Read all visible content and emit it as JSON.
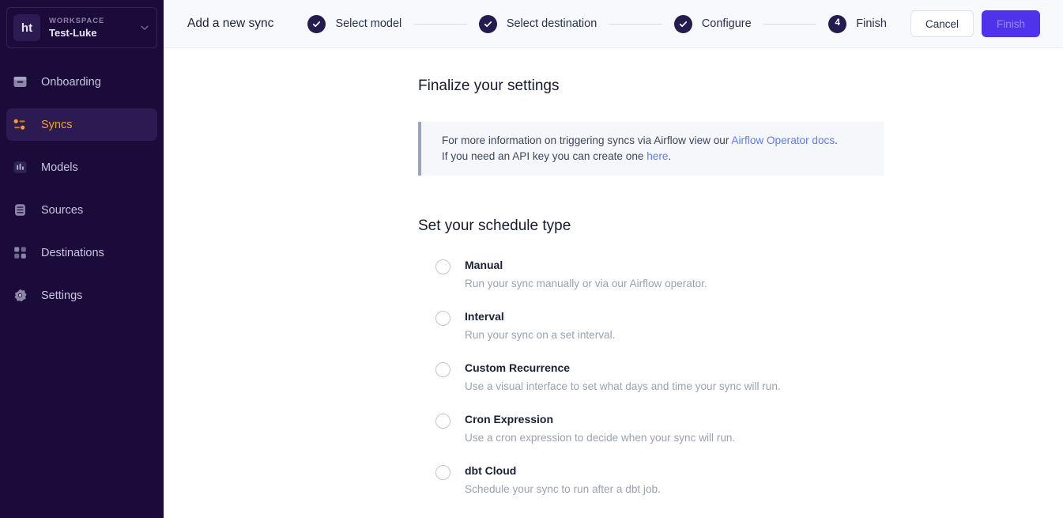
{
  "sidebar": {
    "workspace": {
      "avatar_initials": "ht",
      "label": "WORKSPACE",
      "name": "Test-Luke",
      "chevron_icon": "chevron-down-icon"
    },
    "items": [
      {
        "label": "Onboarding",
        "icon": "onboarding-icon",
        "active": false
      },
      {
        "label": "Syncs",
        "icon": "syncs-icon",
        "active": true
      },
      {
        "label": "Models",
        "icon": "models-icon",
        "active": false
      },
      {
        "label": "Sources",
        "icon": "sources-icon",
        "active": false
      },
      {
        "label": "Destinations",
        "icon": "destinations-icon",
        "active": false
      },
      {
        "label": "Settings",
        "icon": "settings-icon",
        "active": false
      }
    ]
  },
  "header": {
    "title": "Add a new sync",
    "steps": [
      {
        "label": "Select model",
        "state": "complete",
        "marker": "check"
      },
      {
        "label": "Select destination",
        "state": "complete",
        "marker": "check"
      },
      {
        "label": "Configure",
        "state": "complete",
        "marker": "check"
      },
      {
        "label": "Finish",
        "state": "current",
        "marker": "4"
      }
    ],
    "cancel_label": "Cancel",
    "finish_label": "Finish"
  },
  "content": {
    "page_title": "Finalize your settings",
    "infobox": {
      "line1_prefix": "For more information on triggering syncs via Airflow view our ",
      "line1_link": "Airflow Operator docs",
      "line1_suffix": ".",
      "line2_prefix": "If you need an API key you can create one ",
      "line2_link": "here",
      "line2_suffix": "."
    },
    "schedule_title": "Set your schedule type",
    "options": [
      {
        "label": "Manual",
        "desc": "Run your sync manually or via our Airflow operator.",
        "selected": false
      },
      {
        "label": "Interval",
        "desc": "Run your sync on a set interval.",
        "selected": false
      },
      {
        "label": "Custom Recurrence",
        "desc": "Use a visual interface to set what days and time your sync will run.",
        "selected": false
      },
      {
        "label": "Cron Expression",
        "desc": "Use a cron expression to decide when your sync will run.",
        "selected": false
      },
      {
        "label": "dbt Cloud",
        "desc": "Schedule your sync to run after a dbt job.",
        "selected": false
      }
    ]
  },
  "colors": {
    "sidebar_bg": "#1B0B3B",
    "sidebar_active_bg": "#2B1B52",
    "sidebar_active_text": "#F0A028",
    "header_bg": "#F8F9FC",
    "primary_button": "#4F33EA",
    "step_bullet": "#241B4E",
    "link": "#5C7CF2",
    "infobox_bg": "#F6F7FB",
    "infobox_border": "#9AA4BC"
  }
}
